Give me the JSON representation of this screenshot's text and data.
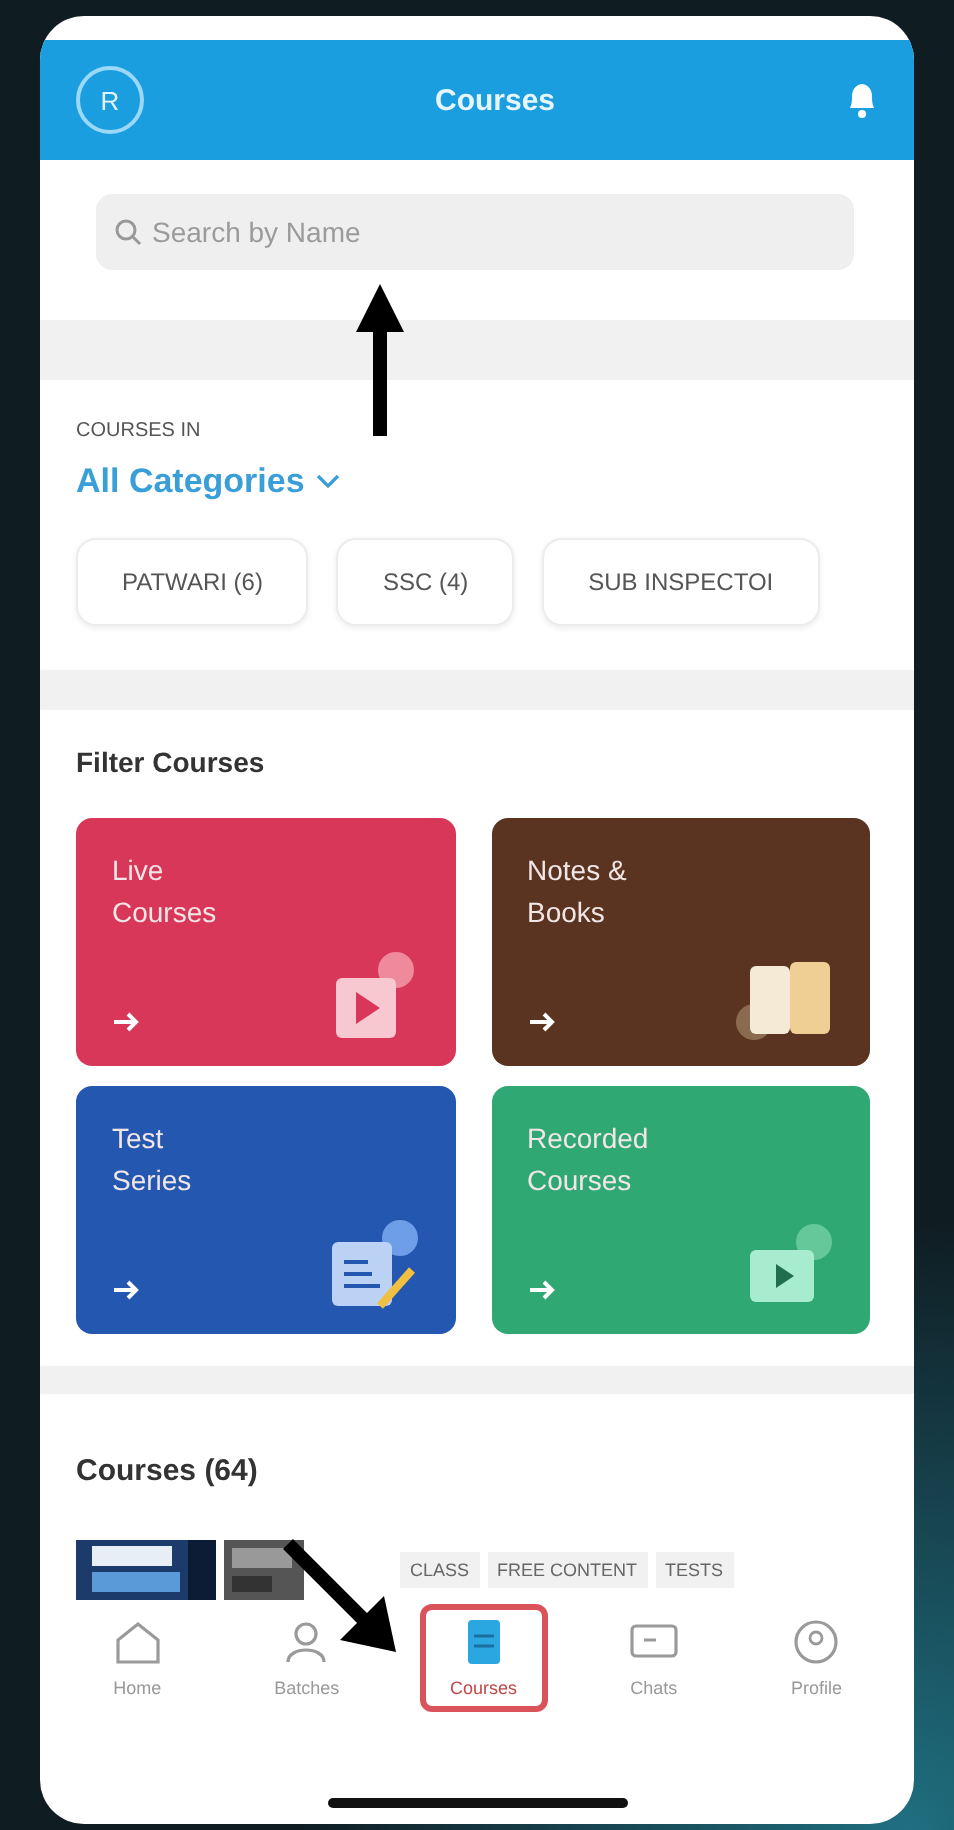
{
  "header": {
    "avatar": "R",
    "title": "Courses"
  },
  "search": {
    "placeholder": "Search by Name"
  },
  "category": {
    "caption": "COURSES IN",
    "value": "All Categories"
  },
  "chips": [
    {
      "label": "PATWARI (6)"
    },
    {
      "label": "SSC (4)"
    },
    {
      "label": "SUB INSPECTOI"
    }
  ],
  "filter": {
    "title": "Filter Courses",
    "cards": [
      {
        "kind": "live",
        "title": "Live Courses",
        "color": "#d9375a"
      },
      {
        "kind": "notes",
        "title": "Notes & Books",
        "color": "#5a3420"
      },
      {
        "kind": "test",
        "title": "Test Series",
        "color": "#2457b0"
      },
      {
        "kind": "recorded",
        "title": "Recorded Courses",
        "color": "#2fa874"
      }
    ]
  },
  "courses": {
    "title": "Courses (64)",
    "tags": [
      "CLASS",
      "FREE CONTENT",
      "TESTS"
    ]
  },
  "nav": [
    {
      "label": "Home",
      "kind": "home",
      "selected": false
    },
    {
      "label": "Batches",
      "kind": "batches",
      "selected": false
    },
    {
      "label": "Courses",
      "kind": "courses",
      "selected": true
    },
    {
      "label": "Chats",
      "kind": "chats",
      "selected": false
    },
    {
      "label": "Profile",
      "kind": "profile",
      "selected": false
    }
  ]
}
